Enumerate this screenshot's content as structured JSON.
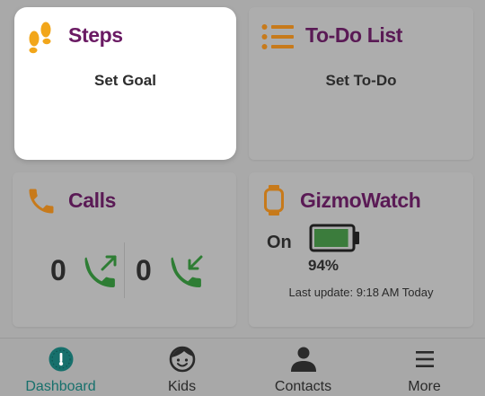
{
  "colors": {
    "title_purple": "#6a1a63",
    "icon_orange": "#c77a1b",
    "steps_yellow": "#f2a61a",
    "call_green": "#2e7d34",
    "battery_green": "#3b7c3c",
    "active_teal": "#17706c",
    "nav_dark": "#2a2a2a"
  },
  "cards": {
    "steps": {
      "title": "Steps",
      "subtitle": "Set Goal",
      "icon": "footsteps-icon"
    },
    "todo": {
      "title": "To-Do List",
      "subtitle": "Set To-Do",
      "icon": "list-icon"
    },
    "calls": {
      "title": "Calls",
      "icon": "phone-icon",
      "outgoing_count": "0",
      "incoming_count": "0",
      "outgoing_icon": "outgoing-call-icon",
      "incoming_icon": "incoming-call-icon"
    },
    "watch": {
      "title": "GizmoWatch",
      "icon": "watch-icon",
      "status": "On",
      "battery_text": "94%",
      "battery_level": 0.94,
      "last_update": "Last update: 9:18 AM Today"
    }
  },
  "nav": {
    "items": [
      {
        "label": "Dashboard",
        "icon": "dashboard-icon",
        "active": true
      },
      {
        "label": "Kids",
        "icon": "kid-face-icon",
        "active": false
      },
      {
        "label": "Contacts",
        "icon": "person-icon",
        "active": false
      },
      {
        "label": "More",
        "icon": "menu-icon",
        "active": false
      }
    ]
  }
}
